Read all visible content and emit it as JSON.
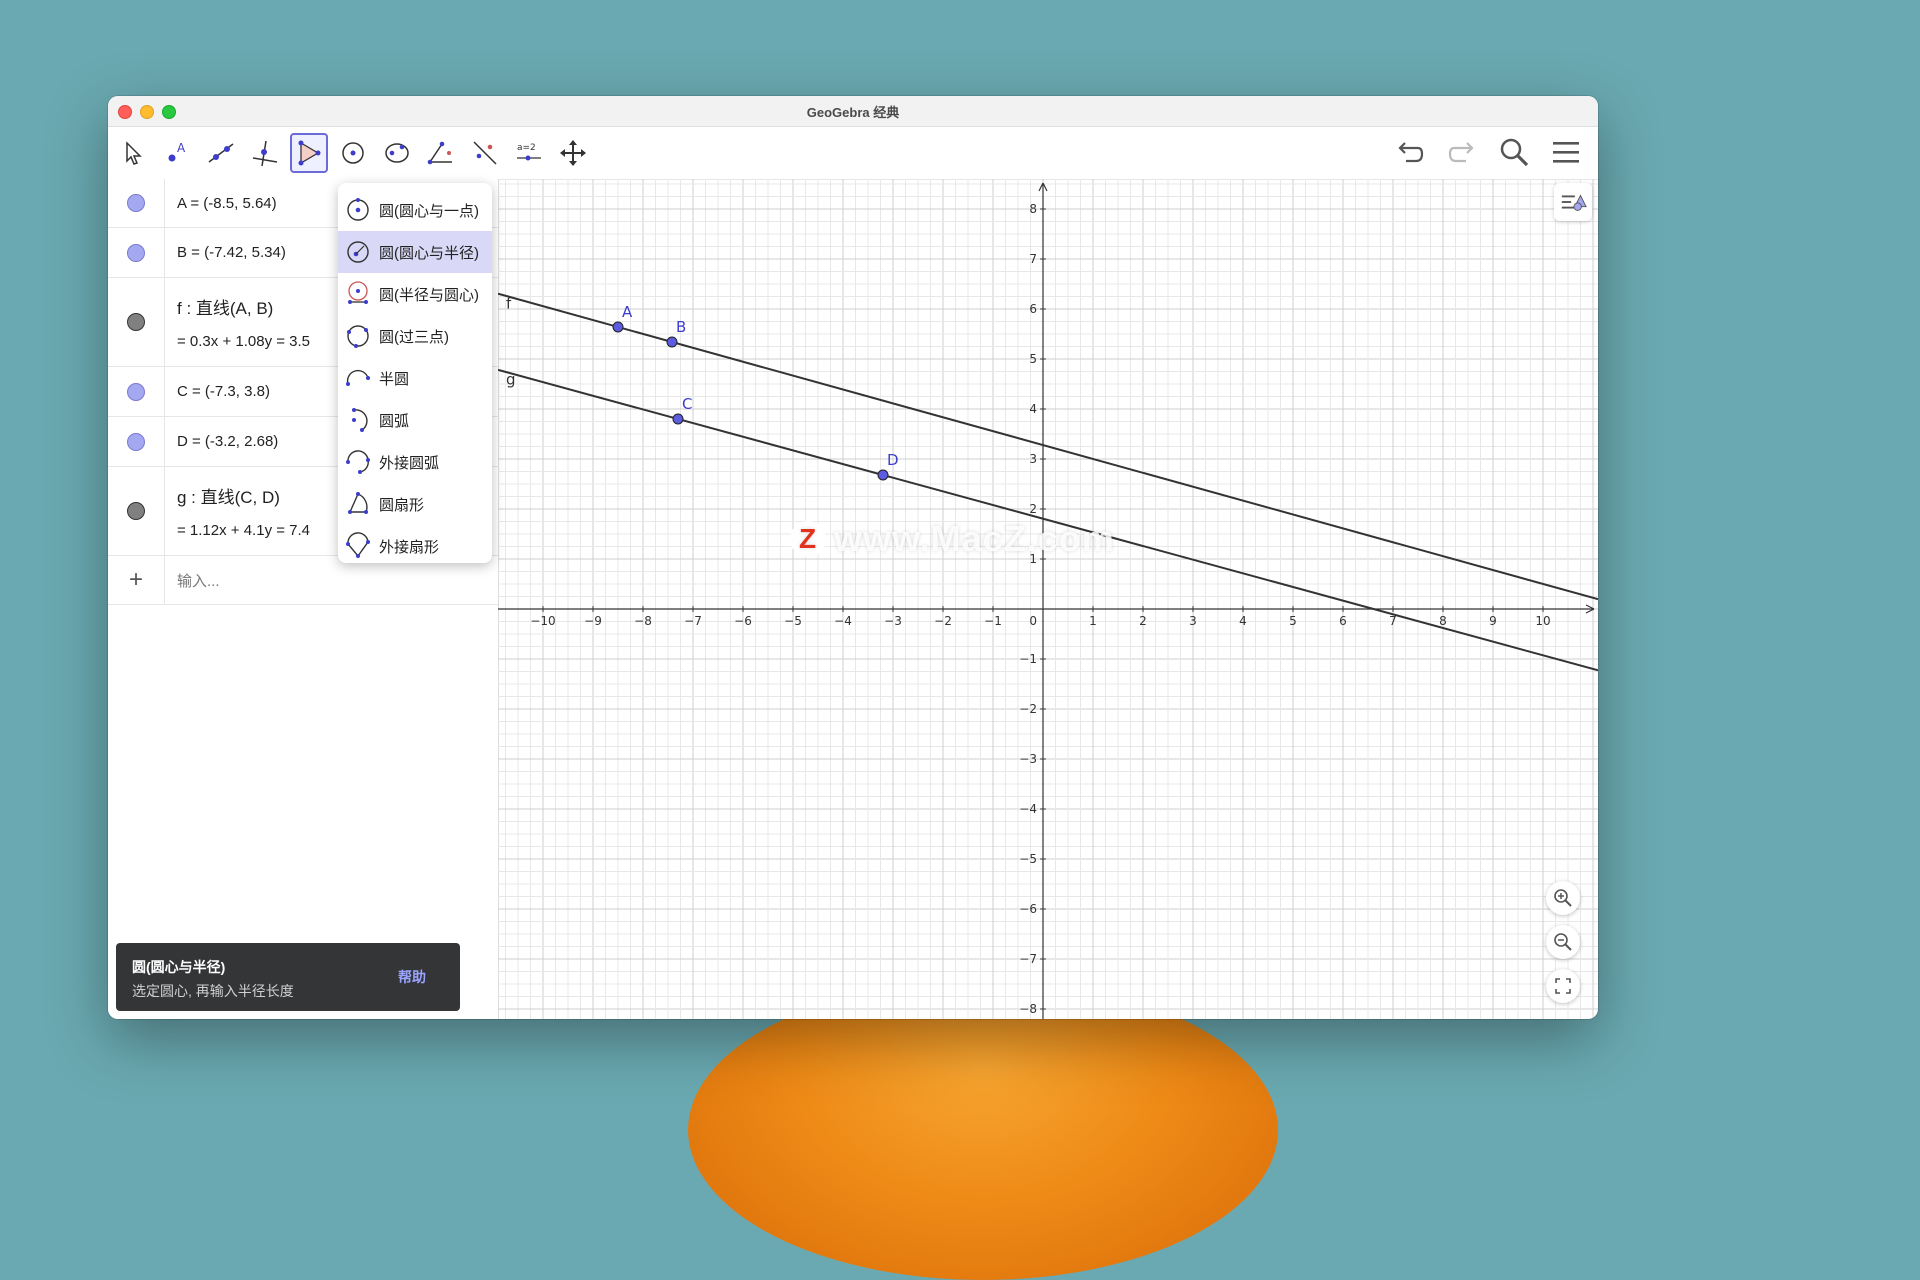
{
  "window": {
    "title": "GeoGebra 经典"
  },
  "watermark": {
    "text": "www.MacZ.com",
    "logo_letter": "Z"
  },
  "toolbar": {
    "tools": [
      {
        "name": "move-tool",
        "icon": "arrow-pointer-icon"
      },
      {
        "name": "point-tool",
        "icon": "point-a-icon"
      },
      {
        "name": "line-tool",
        "icon": "line-icon"
      },
      {
        "name": "perpendicular-tool",
        "icon": "perpendicular-icon"
      },
      {
        "name": "polygon-tool",
        "icon": "polygon-icon",
        "active": true
      },
      {
        "name": "circle-tool",
        "icon": "circle-center-point-icon"
      },
      {
        "name": "ellipse-tool",
        "icon": "ellipse-icon"
      },
      {
        "name": "angle-tool",
        "icon": "angle-icon"
      },
      {
        "name": "reflect-tool",
        "icon": "reflect-icon"
      },
      {
        "name": "slider-tool",
        "icon": "slider-icon",
        "label": "a=2"
      },
      {
        "name": "move-graphics-tool",
        "icon": "move-cross-icon"
      }
    ],
    "right": [
      "undo-icon",
      "redo-icon",
      "search-icon",
      "menu-icon"
    ]
  },
  "algebra": {
    "rows": [
      {
        "id": "A",
        "kind": "point",
        "def": "A = (-8.5, 5.64)"
      },
      {
        "id": "B",
        "kind": "point",
        "def": "B = (-7.42, 5.34)"
      },
      {
        "id": "f",
        "kind": "line",
        "def": "f : 直线(A, B)",
        "val": "=  0.3x + 1.08y = 3.5"
      },
      {
        "id": "C",
        "kind": "point",
        "def": "C = (-7.3, 3.8)"
      },
      {
        "id": "D",
        "kind": "point",
        "def": "D = (-3.2, 2.68)"
      },
      {
        "id": "g",
        "kind": "line",
        "def": "g : 直线(C, D)",
        "val": "=  1.12x + 4.1y = 7.4"
      }
    ],
    "input_placeholder": "输入...",
    "plus": "+"
  },
  "dropdown": {
    "items": [
      {
        "label": "圆(圆心与一点)",
        "icon": "circle-center-point-icon"
      },
      {
        "label": "圆(圆心与半径)",
        "icon": "circle-center-radius-icon",
        "selected": true
      },
      {
        "label": "圆(半径与圆心)",
        "icon": "compass-icon"
      },
      {
        "label": "圆(过三点)",
        "icon": "circle-three-points-icon"
      },
      {
        "label": "半圆",
        "icon": "semicircle-icon"
      },
      {
        "label": "圆弧",
        "icon": "arc-icon"
      },
      {
        "label": "外接圆弧",
        "icon": "circumcircular-arc-icon"
      },
      {
        "label": "圆扇形",
        "icon": "sector-icon"
      },
      {
        "label": "外接扇形",
        "icon": "circumcircular-sector-icon"
      }
    ]
  },
  "graphics": {
    "x_ticks": [
      -10,
      -9,
      -8,
      -7,
      -6,
      -5,
      -4,
      -3,
      -2,
      -1,
      1,
      2,
      3,
      4,
      5,
      6,
      7,
      8,
      9,
      10
    ],
    "y_ticks": [
      8,
      7,
      6,
      5,
      4,
      3,
      2,
      1,
      -1,
      -2,
      -3,
      -4,
      -5,
      -6,
      -7,
      -8
    ],
    "origin_label": "0",
    "points": [
      {
        "name": "A",
        "x": -8.5,
        "y": 5.64
      },
      {
        "name": "B",
        "x": -7.42,
        "y": 5.34
      },
      {
        "name": "C",
        "x": -7.3,
        "y": 3.8
      },
      {
        "name": "D",
        "x": -3.2,
        "y": 2.68
      }
    ],
    "lines": [
      {
        "name": "f",
        "through": [
          "A",
          "B"
        ]
      },
      {
        "name": "g",
        "through": [
          "C",
          "D"
        ]
      }
    ],
    "colors": {
      "point": "#3d3dcc",
      "point_fill": "#5c5ce0",
      "line": "#333333",
      "grid_minor": "#e8e8e8",
      "grid_major": "#cfcfcf"
    }
  },
  "toast": {
    "title": "圆(圆心与半径)",
    "subtitle": "选定圆心, 再输入半径长度",
    "help": "帮助"
  }
}
